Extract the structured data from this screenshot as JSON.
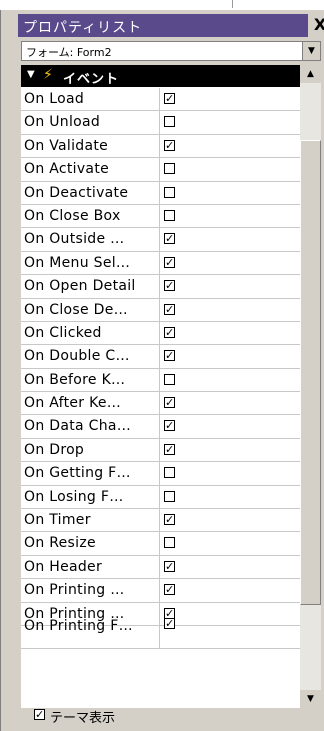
{
  "palette": {
    "title": "プロパティリスト",
    "close_label": "X",
    "form_select": {
      "value": "フォーム: Form2"
    }
  },
  "section": {
    "label": "イベント"
  },
  "events": [
    {
      "label": "On Load",
      "checked": true
    },
    {
      "label": "On Unload",
      "checked": false
    },
    {
      "label": "On Validate",
      "checked": true
    },
    {
      "label": "On Activate",
      "checked": false
    },
    {
      "label": "On Deactivate",
      "checked": false
    },
    {
      "label": "On Close Box",
      "checked": false
    },
    {
      "label": "On Outside …",
      "checked": true
    },
    {
      "label": "On Menu Sel…",
      "checked": true
    },
    {
      "label": "On Open Detail",
      "checked": true
    },
    {
      "label": "On Close De…",
      "checked": true
    },
    {
      "label": "On Clicked",
      "checked": true
    },
    {
      "label": "On Double C…",
      "checked": true
    },
    {
      "label": "On Before K…",
      "checked": false
    },
    {
      "label": "On After Ke…",
      "checked": true
    },
    {
      "label": "On Data Cha…",
      "checked": true
    },
    {
      "label": "On Drop",
      "checked": true
    },
    {
      "label": "On Getting F…",
      "checked": false
    },
    {
      "label": "On Losing F…",
      "checked": false
    },
    {
      "label": "On Timer",
      "checked": true
    },
    {
      "label": "On Resize",
      "checked": false
    },
    {
      "label": "On Header",
      "checked": true
    },
    {
      "label": "On Printing …",
      "checked": true
    },
    {
      "label": "On Printing …",
      "checked": true
    },
    {
      "label": "On Printing F…",
      "checked": true
    }
  ],
  "footer": {
    "theme_label": "テーマ表示",
    "theme_checked": true
  },
  "icons": {
    "collapse": "triangle-down-icon",
    "events": "lightning-icon",
    "dropdown": "chevron-down-icon",
    "scroll_up": "scroll-up-arrow-icon",
    "scroll_down": "scroll-down-arrow-icon"
  }
}
